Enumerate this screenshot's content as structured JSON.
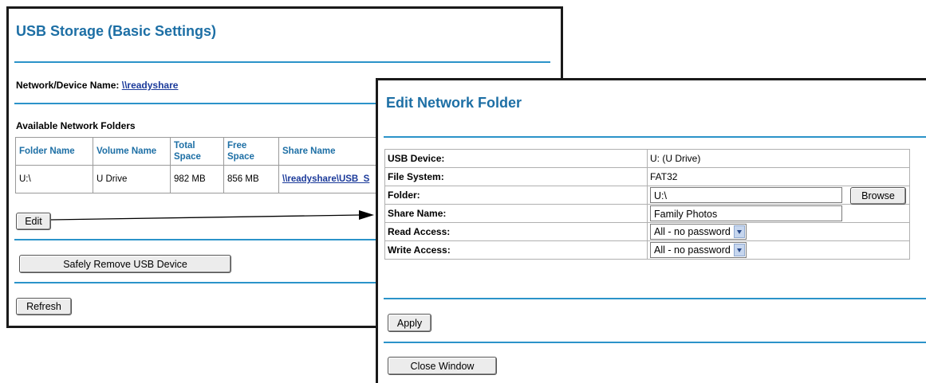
{
  "left_window": {
    "title": "USB Storage (Basic Settings)",
    "network_device_label": "Network/Device Name:",
    "network_device_link": "\\\\readyshare",
    "available_folders_heading": "Available Network Folders",
    "table": {
      "headers": [
        "Folder Name",
        "Volume Name",
        "Total Space",
        "Free Space",
        "Share Name"
      ],
      "rows": [
        [
          "U:\\",
          "U Drive",
          "982 MB",
          "856 MB",
          "\\\\readyshare\\USB_S"
        ]
      ]
    },
    "edit_button": "Edit",
    "safely_remove_button": "Safely Remove USB Device",
    "refresh_button": "Refresh"
  },
  "right_window": {
    "title": "Edit Network Folder",
    "fields": {
      "usb_device": {
        "label": "USB Device:",
        "value": "U: (U Drive)"
      },
      "file_system": {
        "label": "File System:",
        "value": "FAT32"
      },
      "folder": {
        "label": "Folder:",
        "value": "U:\\",
        "button": "Browse"
      },
      "share_name": {
        "label": "Share Name:",
        "value": "Family Photos"
      },
      "read_access": {
        "label": "Read Access:",
        "value": "All - no password"
      },
      "write_access": {
        "label": "Write Access:",
        "value": "All - no password"
      }
    },
    "apply_button": "Apply",
    "close_window_button": "Close Window"
  },
  "colors": {
    "title": "#1d6fa5",
    "divider": "#2b93c9",
    "link": "#1b3a9a"
  }
}
